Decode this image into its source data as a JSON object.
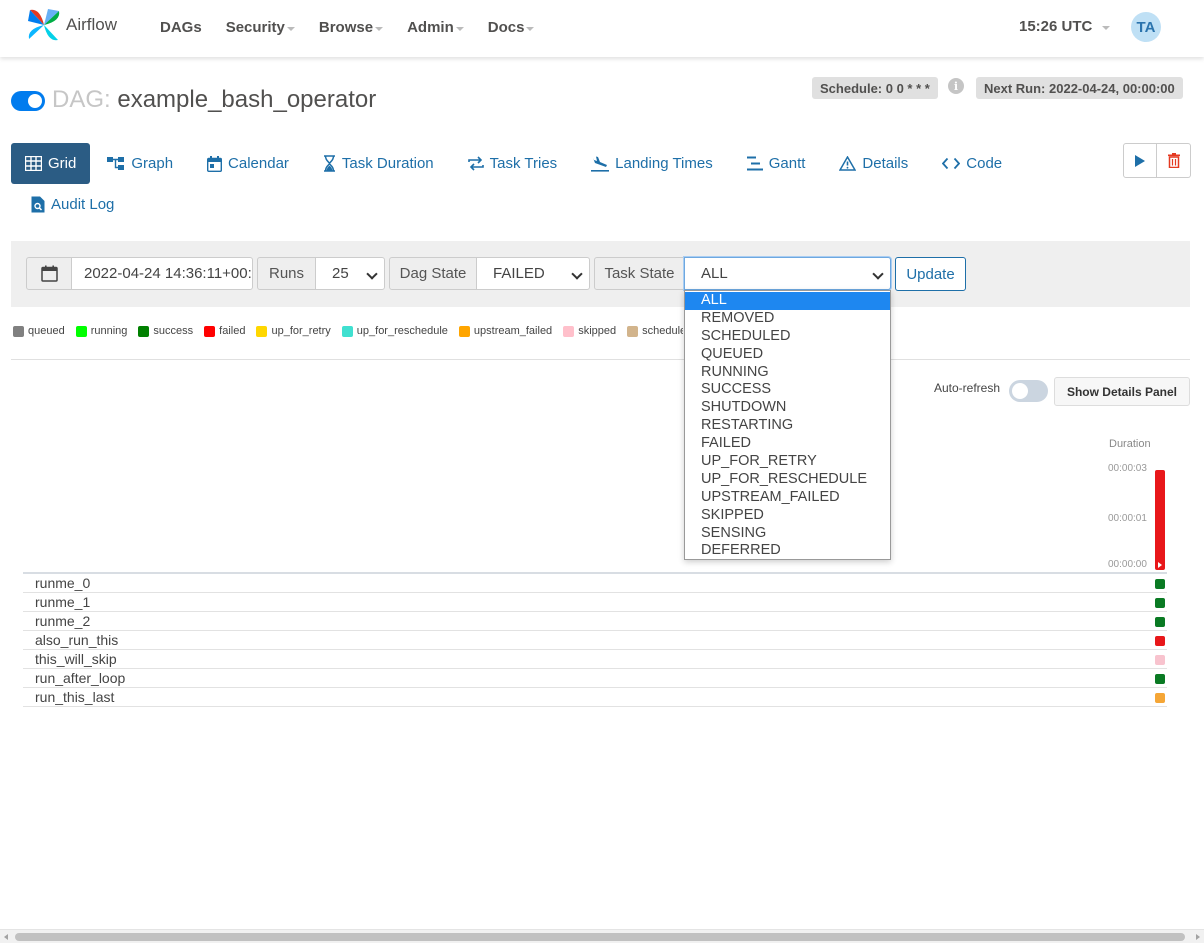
{
  "navbar": {
    "brand": "Airflow",
    "items": [
      {
        "label": "DAGs",
        "has_caret": false
      },
      {
        "label": "Security",
        "has_caret": true
      },
      {
        "label": "Browse",
        "has_caret": true
      },
      {
        "label": "Admin",
        "has_caret": true
      },
      {
        "label": "Docs",
        "has_caret": true
      }
    ],
    "time": "15:26 UTC",
    "avatar": "TA"
  },
  "dag": {
    "prefix": "DAG:",
    "id": "example_bash_operator",
    "enabled": true,
    "schedule": "Schedule: 0 0 * * *",
    "next_run": "Next Run: 2022-04-24, 00:00:00",
    "info_glyph": "i"
  },
  "tabs": [
    {
      "label": "Grid",
      "icon": "grid-icon",
      "active": true
    },
    {
      "label": "Graph",
      "icon": "graph-icon",
      "active": false
    },
    {
      "label": "Calendar",
      "icon": "calendar-icon",
      "active": false
    },
    {
      "label": "Task Duration",
      "icon": "hourglass-icon",
      "active": false
    },
    {
      "label": "Task Tries",
      "icon": "retry-arrows-icon",
      "active": false
    },
    {
      "label": "Landing Times",
      "icon": "plane-landing-icon",
      "active": false
    },
    {
      "label": "Gantt",
      "icon": "gantt-icon",
      "active": false
    },
    {
      "label": "Details",
      "icon": "warning-triangle-icon",
      "active": false
    },
    {
      "label": "Code",
      "icon": "code-brackets-icon",
      "active": false
    },
    {
      "label": "Audit Log",
      "icon": "file-search-icon",
      "active": false
    }
  ],
  "actions": {
    "trigger_icon": "play-icon",
    "delete_icon": "trash-icon"
  },
  "filters": {
    "base_date": "2022-04-24 14:36:11+00:",
    "runs_label": "Runs",
    "runs_value": "25",
    "dag_state_label": "Dag State",
    "dag_state_value": "FAILED",
    "task_state_label": "Task State",
    "task_state_value": "ALL",
    "update_label": "Update"
  },
  "task_state_options": [
    "ALL",
    "REMOVED",
    "SCHEDULED",
    "QUEUED",
    "RUNNING",
    "SUCCESS",
    "SHUTDOWN",
    "RESTARTING",
    "FAILED",
    "UP_FOR_RETRY",
    "UP_FOR_RESCHEDULE",
    "UPSTREAM_FAILED",
    "SKIPPED",
    "SENSING",
    "DEFERRED"
  ],
  "legend": [
    {
      "label": "queued",
      "color": "#808080"
    },
    {
      "label": "running",
      "color": "#00ff00"
    },
    {
      "label": "success",
      "color": "#008000"
    },
    {
      "label": "failed",
      "color": "#ff0000"
    },
    {
      "label": "up_for_retry",
      "color": "#ffd700"
    },
    {
      "label": "up_for_reschedule",
      "color": "#40e0d0"
    },
    {
      "label": "upstream_failed",
      "color": "#ffa500"
    },
    {
      "label": "skipped",
      "color": "#ffc0cb"
    },
    {
      "label": "scheduled",
      "color": "#d2b48c"
    }
  ],
  "grid": {
    "auto_refresh_label": "Auto-refresh",
    "details_button": "Show Details Panel",
    "duration_label": "Duration",
    "duration_ticks": [
      "00:00:03",
      "00:00:01",
      "00:00:00"
    ],
    "run_state_color": "#e8171a",
    "tasks": [
      {
        "name": "runme_0",
        "color": "#0a7a23"
      },
      {
        "name": "runme_1",
        "color": "#0a7a23"
      },
      {
        "name": "runme_2",
        "color": "#0a7a23"
      },
      {
        "name": "also_run_this",
        "color": "#e8171a"
      },
      {
        "name": "this_will_skip",
        "color": "#f8c3ce"
      },
      {
        "name": "run_after_loop",
        "color": "#0a7a23"
      },
      {
        "name": "run_this_last",
        "color": "#f5a636"
      }
    ]
  }
}
